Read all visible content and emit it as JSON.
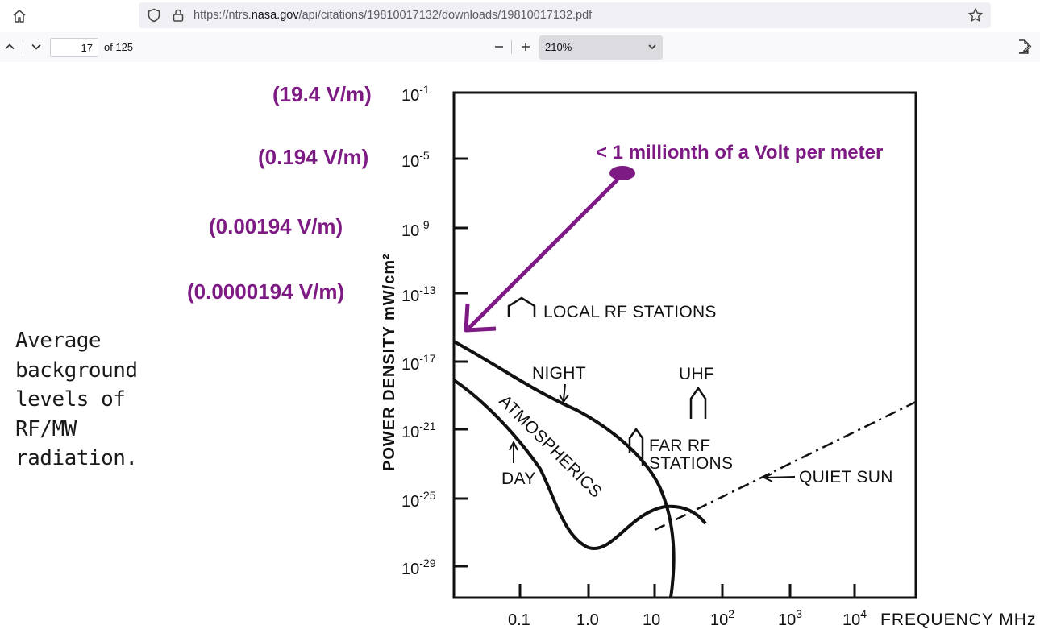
{
  "browser": {
    "url_prefix": "https://ntrs.",
    "url_domain": "nasa.gov",
    "url_path": "/api/citations/19810017132/downloads/19810017132.pdf"
  },
  "pdf_toolbar": {
    "page_number": "17",
    "page_total": "of 125",
    "zoom": "210%"
  },
  "document": {
    "caption": "Average\nbackground\nlevels of\nRF/MW\nradiation.",
    "voltage_labels": [
      "(19.4 V/m)",
      "(0.194 V/m)",
      "(0.00194 V/m)",
      "(0.0000194 V/m)"
    ],
    "annotation_text": "< 1 millionth of a Volt per meter",
    "annotation_color": "#7d1a83"
  },
  "chart_data": {
    "type": "line",
    "ylabel": "POWER DENSITY  mW/cm²",
    "xlabel": "FREQUENCY  MHz",
    "y_ticks": [
      {
        "base": "10",
        "exp": "-1"
      },
      {
        "base": "10",
        "exp": "-5"
      },
      {
        "base": "10",
        "exp": "-9"
      },
      {
        "base": "10",
        "exp": "-13"
      },
      {
        "base": "10",
        "exp": "-17"
      },
      {
        "base": "10",
        "exp": "-21"
      },
      {
        "base": "10",
        "exp": "-25"
      },
      {
        "base": "10",
        "exp": "-29"
      }
    ],
    "x_ticks": [
      {
        "base": "0.1",
        "exp": ""
      },
      {
        "base": "1.0",
        "exp": ""
      },
      {
        "base": "10",
        "exp": ""
      },
      {
        "base": "10",
        "exp": "2"
      },
      {
        "base": "10",
        "exp": "3"
      },
      {
        "base": "10",
        "exp": "4"
      }
    ],
    "labels": {
      "local": "LOCAL  RF STATIONS",
      "night": "NIGHT",
      "uhf": "UHF",
      "atmospherics": "ATMOSPHERICS",
      "day": "DAY",
      "far1": "FAR  RF",
      "far2": "STATIONS",
      "quiet_sun": "QUIET  SUN"
    },
    "scale": "log-log",
    "series": [
      {
        "name": "NIGHT",
        "x": [
          0.012,
          0.1,
          1.0,
          10,
          20
        ],
        "y": [
          -16,
          -18,
          -20,
          -23,
          -25
        ]
      },
      {
        "name": "DAY",
        "x": [
          0.012,
          0.1,
          0.3,
          1.0,
          3,
          10,
          20,
          60
        ],
        "y": [
          -18,
          -20.5,
          -23.5,
          -27,
          -27,
          -25.5,
          -25.5,
          -26
        ]
      },
      {
        "name": "QUIET SUN",
        "x": [
          15,
          100,
          1000,
          10000,
          30000
        ],
        "y": [
          -26.5,
          -25.5,
          -23.5,
          -21.5,
          -20.5
        ]
      }
    ]
  }
}
